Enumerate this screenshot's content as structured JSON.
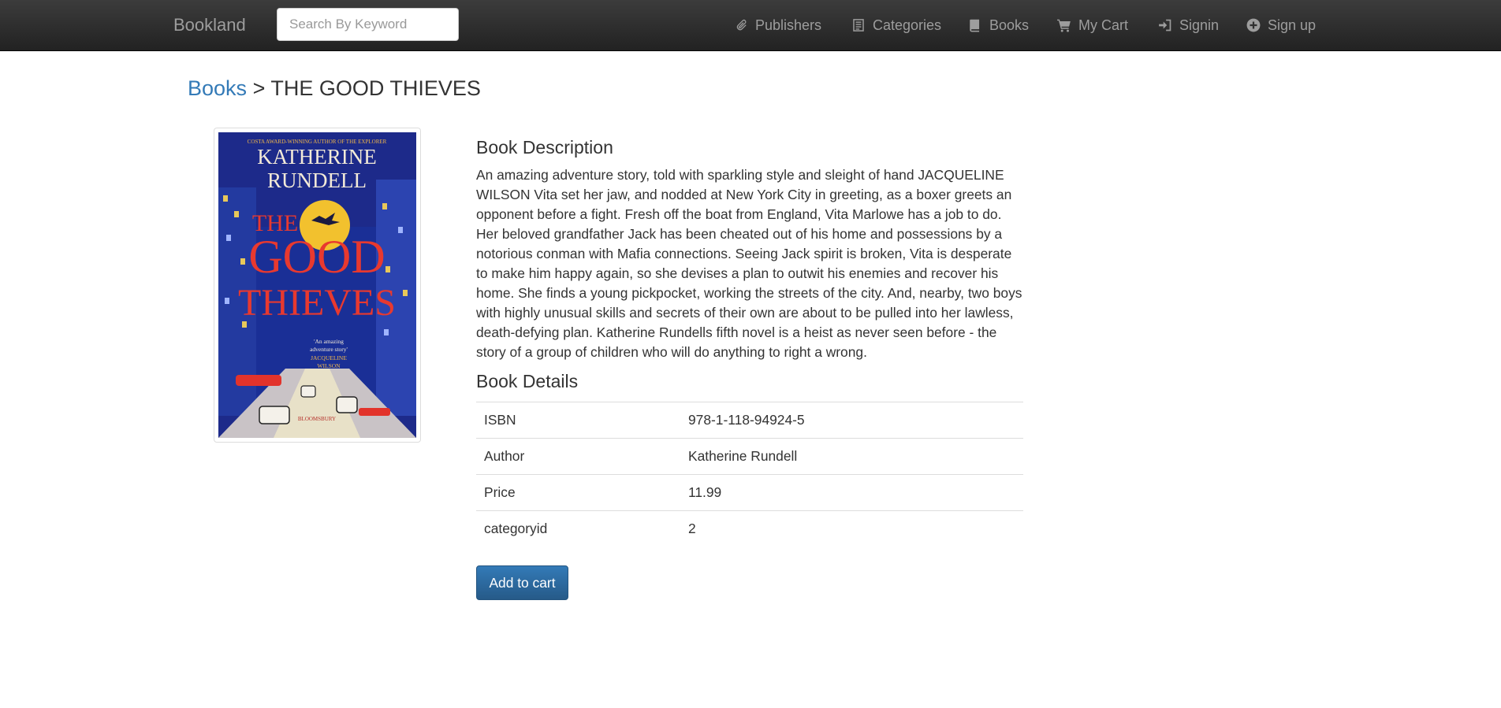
{
  "nav": {
    "brand": "Bookland",
    "search_placeholder": "Search By Keyword",
    "items": [
      {
        "label": "Publishers",
        "icon": "paperclip-icon"
      },
      {
        "label": "Categories",
        "icon": "list-alt-icon"
      },
      {
        "label": "Books",
        "icon": "book-icon"
      },
      {
        "label": "My Cart",
        "icon": "shopping-cart-icon"
      },
      {
        "label": "Signin",
        "icon": "log-in-icon"
      },
      {
        "label": "Sign up",
        "icon": "plus-sign-icon"
      }
    ]
  },
  "breadcrumb": {
    "link": "Books",
    "separator": ">",
    "current": "THE GOOD THIEVES"
  },
  "cover": {
    "top_line": "COSTA AWARD-WINNING AUTHOR OF THE EXPLORER",
    "author_line1": "KATHERINE",
    "author_line2": "RUNDELL",
    "title_line1": "THE",
    "title_line2": "GOOD",
    "title_line3": "THIEVES",
    "blurb_line1": "'An amazing",
    "blurb_line2": "adventure story'",
    "blurb_author1": "JACQUELINE",
    "blurb_author2": "WILSON",
    "publisher": "BLOOMSBURY"
  },
  "description": {
    "heading": "Book Description",
    "text": "An amazing adventure story, told with sparkling style and sleight of hand JACQUELINE WILSON Vita set her jaw, and nodded at New York City in greeting, as a boxer greets an opponent before a fight. Fresh off the boat from England, Vita Marlowe has a job to do. Her beloved grandfather Jack has been cheated out of his home and possessions by a notorious conman with Mafia connections. Seeing Jack spirit is broken, Vita is desperate to make him happy again, so she devises a plan to outwit his enemies and recover his home. She finds a young pickpocket, working the streets of the city. And, nearby, two boys with highly unusual skills and secrets of their own are about to be pulled into her lawless, death-defying plan. Katherine Rundells fifth novel is a heist as never seen before - the story of a group of children who will do anything to right a wrong."
  },
  "details": {
    "heading": "Book Details",
    "rows": [
      {
        "key": "ISBN",
        "value": "978-1-118-94924-5"
      },
      {
        "key": "Author",
        "value": "Katherine Rundell"
      },
      {
        "key": "Price",
        "value": "11.99"
      },
      {
        "key": "categoryid",
        "value": "2"
      }
    ]
  },
  "actions": {
    "add_to_cart": "Add to cart"
  },
  "colors": {
    "link": "#337ab7",
    "button": "#286090",
    "navbar": "#222222"
  }
}
